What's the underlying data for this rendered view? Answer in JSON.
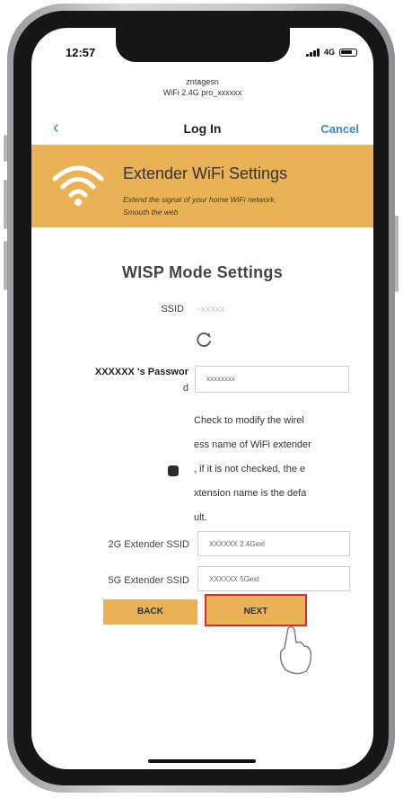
{
  "status_bar": {
    "time": "12:57",
    "network": "4G"
  },
  "browser": {
    "url_line1": "zntagesn",
    "url_line2": "WiFi 2.4G pro_xxxxxx"
  },
  "nav": {
    "back_icon": "chevron-left-icon",
    "title": "Log In",
    "cancel_label": "Cancel"
  },
  "banner": {
    "icon": "wifi-icon",
    "title": "Extender WiFi Settings",
    "subtitle_line1": "Extend the signal of your home WiFi network,",
    "subtitle_line2": "Smooth the web",
    "color": "#e9b255"
  },
  "form": {
    "heading": "WISP Mode Settings",
    "ssid_label": "SSID",
    "ssid_value": "~XXXXX",
    "password_label": "XXXXXX 's Passwor",
    "password_label_cont": "d",
    "password_value": "xxxxxxxx",
    "checkbox_text": [
      "Check to modify the wirel",
      "ess name of WiFi extender",
      ", if it is not checked, the e",
      "xtension name is the defa",
      "ult."
    ],
    "ssid_2g_label": "2G Extender SSID",
    "ssid_2g_value": "XXXXXX 2.4Gext",
    "ssid_5g_label": "5G Extender SSID",
    "ssid_5g_value": "XXXXXX 5Gext",
    "back_label": "BACK",
    "next_label": "NEXT",
    "highlight_color": "#e0282e"
  }
}
